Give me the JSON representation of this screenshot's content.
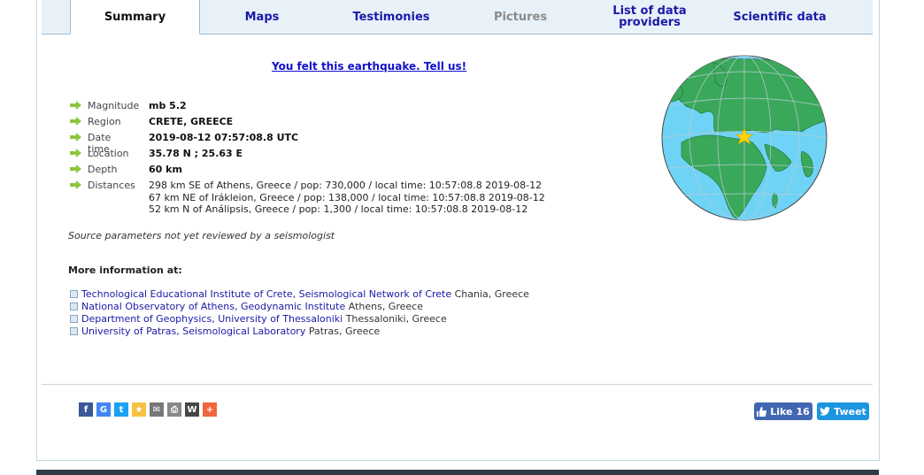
{
  "tabs": [
    {
      "label": "Summary",
      "state": "active"
    },
    {
      "label": "Maps",
      "state": "normal"
    },
    {
      "label": "Testimonies",
      "state": "normal"
    },
    {
      "label": "Pictures",
      "state": "disabled"
    },
    {
      "label": "List of data\nproviders",
      "state": "normal"
    },
    {
      "label": "Scientific data",
      "state": "normal"
    }
  ],
  "felt_link": "You felt this earthquake. Tell us!",
  "params": {
    "magnitude": {
      "label": "Magnitude",
      "value": "mb 5.2"
    },
    "region": {
      "label": "Region",
      "value": "CRETE, GREECE"
    },
    "datetime": {
      "label": "Date time",
      "value": "2019-08-12 07:57:08.8 UTC"
    },
    "location": {
      "label": "Location",
      "value": "35.78 N ; 25.63 E"
    },
    "depth": {
      "label": "Depth",
      "value": "60 km"
    },
    "distances": {
      "label": "Distances",
      "lines": [
        "298 km SE of Athens, Greece / pop: 730,000 / local time: 10:57:08.8 2019-08-12",
        "67 km NE of Irákleion, Greece / pop: 138,000 / local time: 10:57:08.8 2019-08-12",
        "52 km N of Análipsis, Greece / pop: 1,300 / local time: 10:57:08.8 2019-08-12"
      ]
    }
  },
  "source_note": "Source parameters not yet reviewed by a seismologist",
  "more_info_title": "More information at:",
  "providers": [
    {
      "link": "Technological Educational Institute of Crete, Seismological Network of Crete",
      "place": " Chania, Greece"
    },
    {
      "link": "National Observatory of Athens, Geodynamic Institute",
      "place": " Athens, Greece"
    },
    {
      "link": "Department of Geophysics, University of Thessaloniki",
      "place": " Thessaloniki, Greece"
    },
    {
      "link": "University of Patras, Seismological Laboratory",
      "place": " Patras, Greece"
    }
  ],
  "share_icons": [
    {
      "name": "facebook-share-icon",
      "glyph": "f",
      "color": "#3b5998"
    },
    {
      "name": "google-share-icon",
      "glyph": "G",
      "color": "#4285f4"
    },
    {
      "name": "twitter-share-icon",
      "glyph": "t",
      "color": "#1da1f2"
    },
    {
      "name": "favorite-star-icon",
      "glyph": "★",
      "color": "#f5c242"
    },
    {
      "name": "email-share-icon",
      "glyph": "✉",
      "color": "#777777"
    },
    {
      "name": "print-icon",
      "glyph": "⎙",
      "color": "#888888"
    },
    {
      "name": "wordpress-share-icon",
      "glyph": "W",
      "color": "#464646"
    },
    {
      "name": "more-share-icon",
      "glyph": "+",
      "color": "#f0653f"
    }
  ],
  "facebook_like": {
    "label": "Like",
    "count": "16"
  },
  "tweet": {
    "label": "Tweet"
  },
  "colors": {
    "accent_link": "#1a1aa6",
    "arrow_green": "#8cc63f",
    "ocean": "#6fd3f5",
    "land": "#3aa85a"
  }
}
